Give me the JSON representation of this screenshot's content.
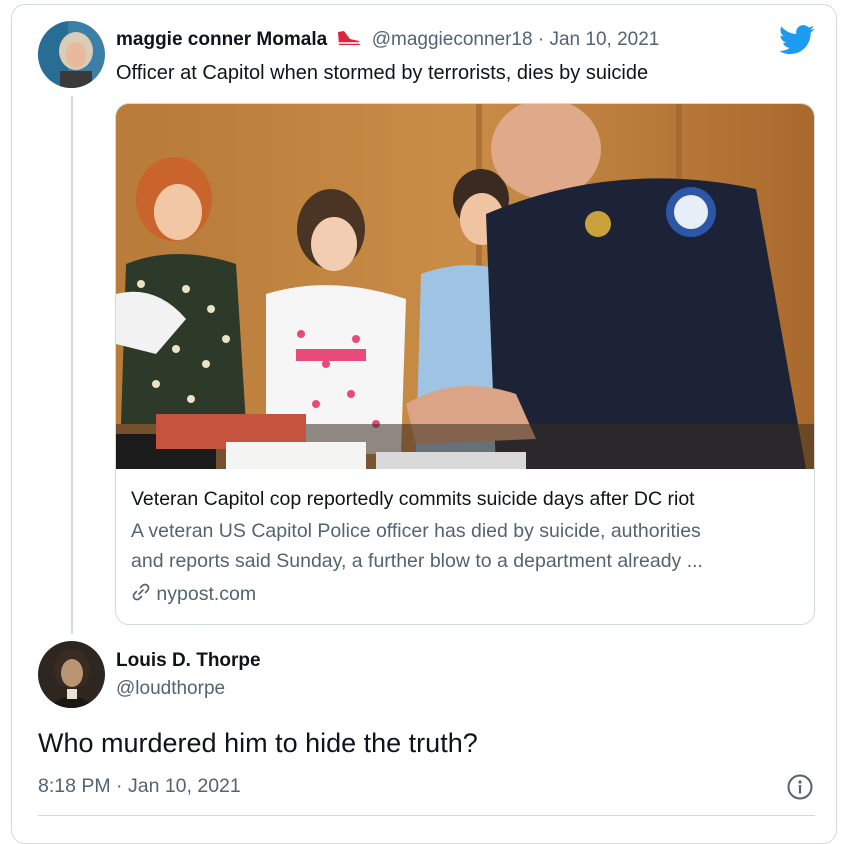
{
  "tweet": {
    "author_name": "maggie conner Momala",
    "author_handle": "@maggieconner18",
    "separator": "·",
    "date": "Jan 10, 2021",
    "text": "Officer at Capitol when stormed by terrorists, dies by suicide",
    "name_badge_icon": "sneaker-icon",
    "logo_icon": "twitter-bird-icon",
    "accent_color": "#1d9bf0"
  },
  "link_card": {
    "image_description_icon": "news-photo",
    "title": "Veteran Capitol cop reportedly commits suicide days after DC riot",
    "description_line1": "A veteran US Capitol Police officer has died by suicide, authorities",
    "description_line2": "and reports said Sunday, a further blow to a department already ...",
    "domain": "nypost.com",
    "domain_icon": "link-icon"
  },
  "reply": {
    "author_name": "Louis D. Thorpe",
    "author_handle": "@loudthorpe",
    "text": "Who murdered him to hide the truth?",
    "time": "8:18 PM",
    "separator": "·",
    "date": "Jan 10, 2021",
    "info_icon": "info-icon"
  }
}
